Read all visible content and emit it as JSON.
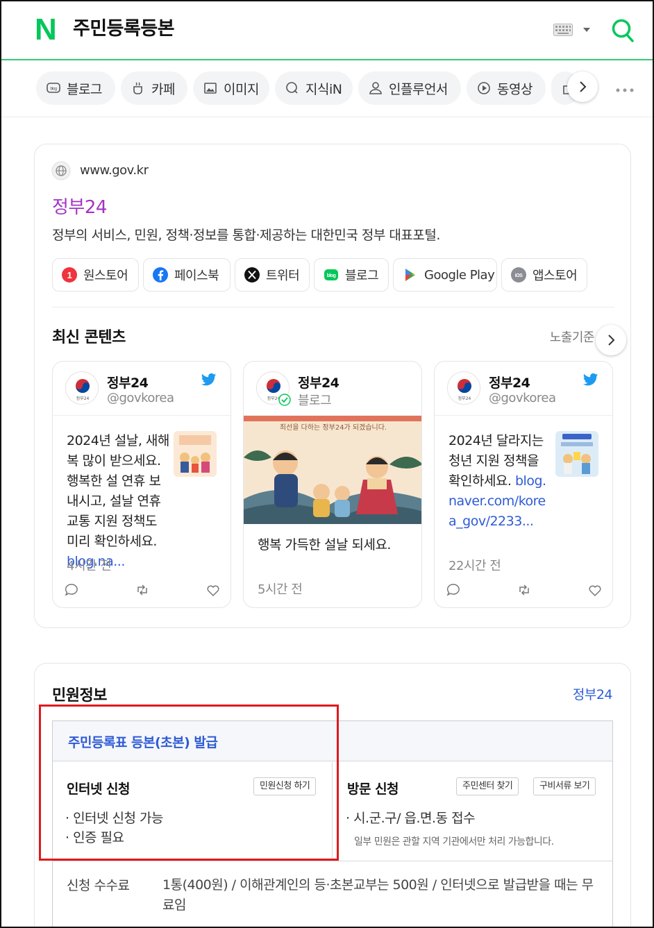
{
  "header": {
    "logo": "N",
    "query": "주민등록등본"
  },
  "tabs": [
    {
      "label": "블로그",
      "icon": "blog-icon"
    },
    {
      "label": "카페",
      "icon": "cafe-icon"
    },
    {
      "label": "이미지",
      "icon": "image-icon"
    },
    {
      "label": "지식iN",
      "icon": "kin-icon"
    },
    {
      "label": "인플루언서",
      "icon": "person-icon"
    },
    {
      "label": "동영상",
      "icon": "play-icon"
    }
  ],
  "site": {
    "url": "www.gov.kr",
    "title": "정부24",
    "description": "정부의 서비스, 민원, 정책·정보를 통합·제공하는 대한민국 정부 대표포털.",
    "links": [
      {
        "label": "원스토어",
        "icon": "onestore-icon"
      },
      {
        "label": "페이스북",
        "icon": "facebook-icon"
      },
      {
        "label": "트위터",
        "icon": "x-icon"
      },
      {
        "label": "블로그",
        "icon": "blog-icon"
      },
      {
        "label": "Google Play",
        "icon": "google-play-icon"
      },
      {
        "label": "앱스토어",
        "icon": "ios-icon"
      }
    ]
  },
  "latest": {
    "title": "최신 콘텐츠",
    "criteria": "노출기준",
    "posts": [
      {
        "name": "정부24",
        "handle": "@govkorea",
        "text": "2024년 설날, 새해 복 많이 받으세요. 행복한 설 연휴 보내시고, 설날 연휴 교통 지원 정책도 미리 확인하세요. ",
        "link": "blog.na...",
        "time": "4시간 전"
      },
      {
        "name": "정부24",
        "handle": "블로그",
        "image_caption": "최선을 다하는 정부24가 되겠습니다.",
        "text": "행복 가득한 설날 되세요.",
        "time": "5시간 전"
      },
      {
        "name": "정부24",
        "handle": "@govkorea",
        "text": "2024년 달라지는 청년 지원 정책을 확인하세요. ",
        "link": "blog.naver.com/korea_gov/2233...",
        "time": "22시간 전"
      }
    ],
    "avatar_label": "정부24"
  },
  "civil": {
    "title": "민원정보",
    "source": "정부24",
    "service": "주민등록표 등본(초본) 발급",
    "online": {
      "title": "인터넷 신청",
      "button": "민원신청 하기",
      "bullets": [
        "· 인터넷 신청 가능",
        "· 인증 필요"
      ]
    },
    "visit": {
      "title": "방문 신청",
      "button1": "주민센터 찾기",
      "button2": "구비서류 보기",
      "bullet": "· 시.군.구/ 읍.면.동 접수",
      "note": "일부 민원은 관할 지역 기관에서만 처리 가능합니다."
    },
    "fee_label": "신청 수수료",
    "fee_value": "1통(400원) / 이해관계인의 등·초본교부는 500원 / 인터넷으로 발급받을 때는 무료임"
  },
  "colors": {
    "brand": "#03c75a",
    "title_purple": "#a433c4",
    "link_blue": "#2e5bd6",
    "highlight_red": "#e0191c"
  }
}
